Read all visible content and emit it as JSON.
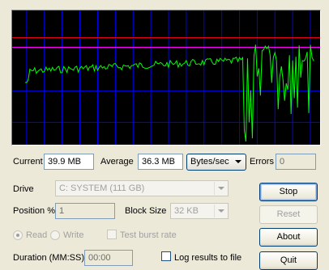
{
  "graph": {
    "background": "#000000",
    "grid_color": "#0000ff",
    "trace_color": "#00ff00",
    "max_line_color": "#ff0000",
    "avg_line_color": "#ff00ff"
  },
  "stats": {
    "current_label": "Current",
    "current_value": "39.9 MB",
    "average_label": "Average",
    "average_value": "36.3 MB",
    "units_value": "Bytes/sec",
    "errors_label": "Errors",
    "errors_value": "0"
  },
  "drive": {
    "label": "Drive",
    "value": "C: SYSTEM (111 GB)"
  },
  "position": {
    "label": "Position %",
    "value": "1"
  },
  "block_size": {
    "label": "Block Size",
    "value": "32 KB"
  },
  "mode": {
    "read_label": "Read",
    "write_label": "Write",
    "read_checked": true
  },
  "test_burst": {
    "label": "Test burst rate"
  },
  "duration": {
    "label": "Duration (MM:SS)",
    "value": "00:00"
  },
  "log": {
    "label": "Log results to file"
  },
  "buttons": {
    "stop": "Stop",
    "reset": "Reset",
    "about": "About",
    "quit": "Quit"
  }
}
